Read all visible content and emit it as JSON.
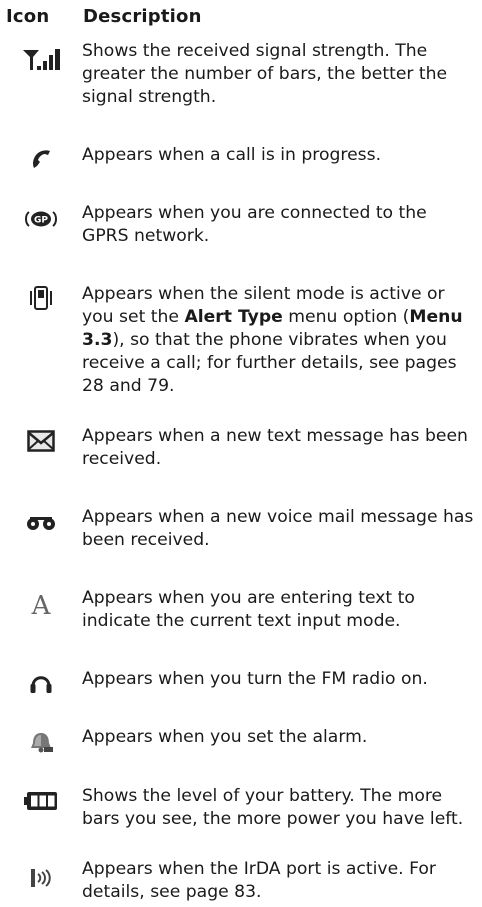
{
  "header": {
    "icon_col": "Icon",
    "desc_col": "Description"
  },
  "rows": [
    {
      "icon": "signal-strength-icon",
      "text": "Shows the received signal strength. The greater the number of bars, the better the signal strength."
    },
    {
      "icon": "call-in-progress-icon",
      "text": "Appears when a call is in progress."
    },
    {
      "icon": "gprs-icon",
      "text": "Appears when you are connected to the GPRS network."
    },
    {
      "icon": "vibrate-icon",
      "parts": {
        "a": "Appears when the silent mode is active or you set the ",
        "b": "Alert Type",
        "c": " menu option (",
        "d": "Menu 3.3",
        "e": "), so that the phone vibrates when you receive a call; for further details, see pages 28 and 79."
      }
    },
    {
      "icon": "text-message-icon",
      "text": "Appears when a new text message has been received."
    },
    {
      "icon": "voice-mail-icon",
      "text": "Appears when a new voice mail message has been received."
    },
    {
      "icon": "text-input-mode-icon",
      "text": "Appears when you are entering text to indicate the current text input mode."
    },
    {
      "icon": "fm-radio-icon",
      "text": " Appears when you turn the FM radio on."
    },
    {
      "icon": "alarm-icon",
      "text": "Appears when you set the alarm."
    },
    {
      "icon": "battery-icon",
      "text": "Shows the level of your battery. The more bars you see, the more power you have left."
    },
    {
      "icon": "irda-icon",
      "text": "Appears when the IrDA port is active. For details, see page 83."
    }
  ]
}
